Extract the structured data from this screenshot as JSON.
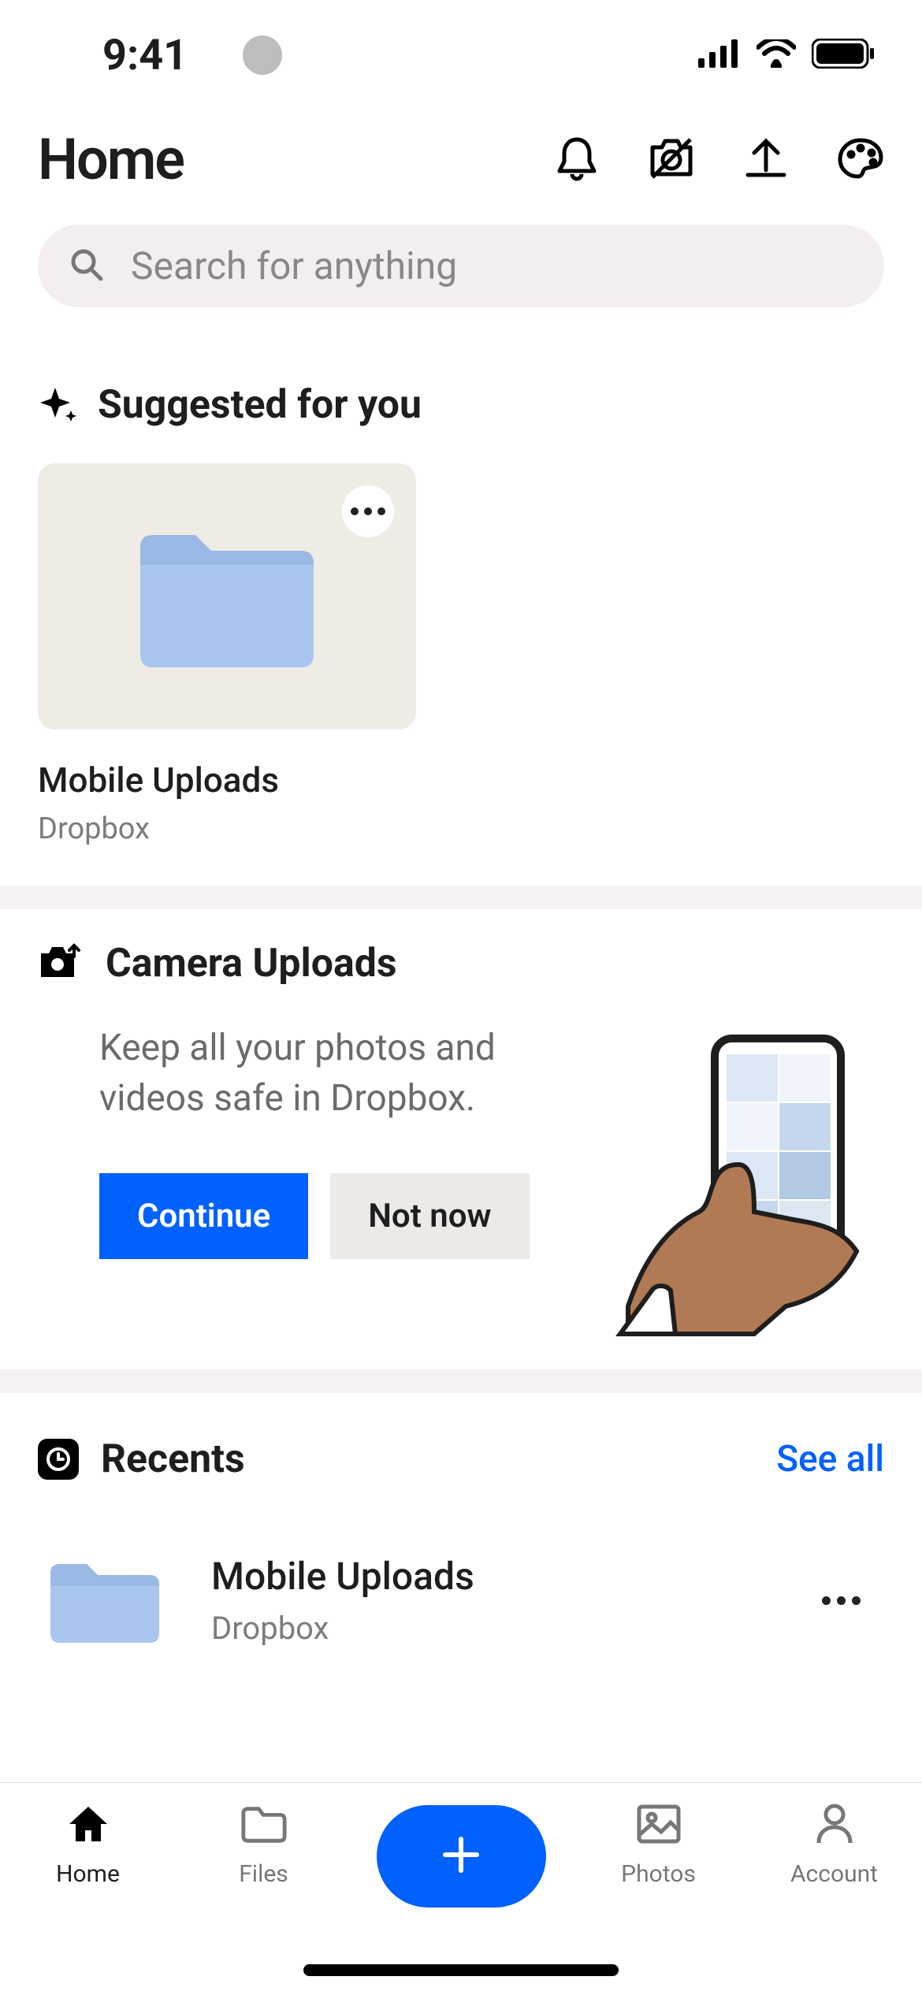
{
  "status": {
    "time": "9:41"
  },
  "header": {
    "title": "Home"
  },
  "search": {
    "placeholder": "Search for anything"
  },
  "suggested": {
    "title": "Suggested for you",
    "items": [
      {
        "name": "Mobile Uploads",
        "sub": "Dropbox"
      }
    ]
  },
  "camera_uploads": {
    "title": "Camera Uploads",
    "description": "Keep all your photos and videos safe in Dropbox.",
    "primary": "Continue",
    "secondary": "Not now"
  },
  "recents": {
    "title": "Recents",
    "see_all": "See all",
    "items": [
      {
        "name": "Mobile Uploads",
        "sub": "Dropbox"
      }
    ]
  },
  "tabs": {
    "home": "Home",
    "files": "Files",
    "photos": "Photos",
    "account": "Account"
  }
}
